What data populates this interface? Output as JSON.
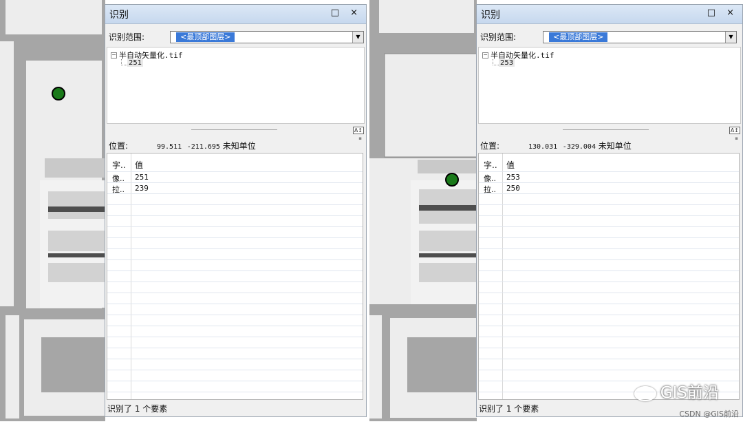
{
  "panels": [
    {
      "title": "识别",
      "window_buttons": "□ ×",
      "scope_label": "识别范围:",
      "scope_value": "<最顶部图层>",
      "tree_root": "半自动矢量化.tif",
      "tree_leaf": "251",
      "location_label": "位置:",
      "location_x": "99.511",
      "location_y": "-211.695",
      "location_unit": "未知单位",
      "columns": [
        "字..",
        "值"
      ],
      "rows": [
        {
          "field": "像..",
          "value": "251"
        },
        {
          "field": "拉..",
          "value": "239"
        }
      ],
      "status": "识别了 1 个要素"
    },
    {
      "title": "识别",
      "window_buttons": "□ ×",
      "scope_label": "识别范围:",
      "scope_value": "<最顶部图层>",
      "tree_root": "半自动矢量化.tif",
      "tree_leaf": "253",
      "location_label": "位置:",
      "location_x": "130.031",
      "location_y": "-329.004",
      "location_unit": "未知单位",
      "columns": [
        "字..",
        "值"
      ],
      "rows": [
        {
          "field": "像..",
          "value": "253"
        },
        {
          "field": "拉..",
          "value": "250"
        }
      ],
      "status": "识别了 1 个要素"
    }
  ],
  "watermark": {
    "main": "GIS前沿",
    "sub": "CSDN @GIS前沿"
  },
  "colors": {
    "map_background": "#a6a6a6",
    "building": "#ededed",
    "point_marker": "#1a7a1a",
    "selection": "#3a79d8"
  },
  "icons": {
    "tree_toggle": "minus-box-icon",
    "dropdown": "chevron-down-icon",
    "sort": "sort-icon",
    "watermark": "wechat-icon"
  }
}
